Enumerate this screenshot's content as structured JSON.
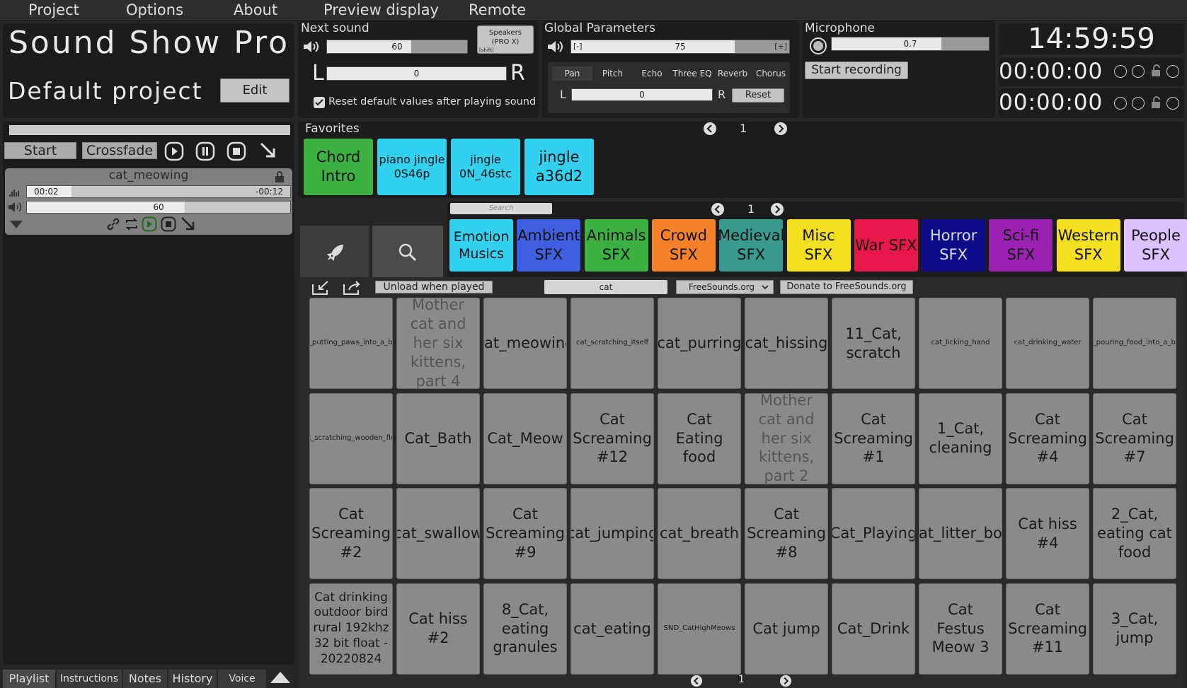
{
  "menu": [
    "Project",
    "Options",
    "About",
    "Preview display",
    "Remote"
  ],
  "app": {
    "title": "Sound Show Pro",
    "project_name": "Default project",
    "edit_label": "Edit"
  },
  "next_sound": {
    "title": "Next sound",
    "volume": "60",
    "volume_level": 0.6,
    "pan": "0",
    "left": "L",
    "right": "R",
    "output_line1": "Speakers",
    "output_line2": "(PRO X)",
    "output_hint": "[shift]",
    "reset_checkbox": "Reset default values after playing sound",
    "reset_checked": true
  },
  "global": {
    "title": "Global Parameters",
    "minus": "[-]",
    "plus": "[+]",
    "volume": "75",
    "volume_level": 0.75,
    "tabs": [
      "Pan",
      "Pitch",
      "Echo",
      "Three EQ",
      "Reverb",
      "Chorus"
    ],
    "pan_value": "0",
    "left": "L",
    "right": "R",
    "reset_label": "Reset"
  },
  "microphone": {
    "title": "Microphone",
    "value": "0.7",
    "level": 0.7,
    "record_label": "Start recording"
  },
  "clock": {
    "time": "14:59:59",
    "timer1": "00:00:00",
    "timer2": "00:00:00"
  },
  "playlist": {
    "start_label": "Start",
    "crossfade_label": "Crossfade",
    "track": {
      "name": "cat_meowing",
      "elapsed": "00:02",
      "remaining": "-00:12",
      "progress": 0.17,
      "volume": "60",
      "volume_level": 0.6
    }
  },
  "favorites": {
    "title": "Favorites",
    "page": "1",
    "items": [
      {
        "label": "Chord Intro",
        "color": "#3cb043"
      },
      {
        "label": "piano jingle 0S46p",
        "color": "#33d1f0"
      },
      {
        "label": "jingle 0N_46stc",
        "color": "#33d1f0"
      },
      {
        "label": "jingle a36d2",
        "color": "#33d1f0"
      }
    ]
  },
  "categories_bar": {
    "search_placeholder": "Search",
    "page": "1",
    "items": [
      {
        "label": "Emotion Musics",
        "color": "#33d1f0",
        "text": "#111"
      },
      {
        "label": "Ambient SFX",
        "color": "#3f5fe0",
        "text": "#111"
      },
      {
        "label": "Animals SFX",
        "color": "#3cb043",
        "text": "#111"
      },
      {
        "label": "Crowd SFX",
        "color": "#f5822a",
        "text": "#111"
      },
      {
        "label": "Medieval SFX",
        "color": "#3a9a90",
        "text": "#111"
      },
      {
        "label": "Misc SFX",
        "color": "#f4e021",
        "text": "#111"
      },
      {
        "label": "War SFX",
        "color": "#e8174a",
        "text": "#111"
      },
      {
        "label": "Horror SFX",
        "color": "#0d0d8a",
        "text": "#ddd"
      },
      {
        "label": "Sci-fi SFX",
        "color": "#9b22b0",
        "text": "#111"
      },
      {
        "label": "Western SFX",
        "color": "#f4e021",
        "text": "#111"
      },
      {
        "label": "People SFX",
        "color": "#dcc2ff",
        "text": "#111"
      }
    ]
  },
  "browser": {
    "unload_label": "Unload when played",
    "search_value": "cat",
    "source_option": "FreeSounds.org",
    "donate_label": "Donate to FreeSounds.org",
    "page": "1",
    "sounds": [
      {
        "label": "cat_putting_paws_into_a_bowl",
        "size": "small"
      },
      {
        "label": "Mother cat and her six kittens, part 4",
        "size": "big",
        "dim": true
      },
      {
        "label": "cat_meowing",
        "size": "big"
      },
      {
        "label": "cat_scratching_itself",
        "size": "small"
      },
      {
        "label": "cat_purring",
        "size": "big"
      },
      {
        "label": "cat_hissing",
        "size": "big"
      },
      {
        "label": "11_Cat, scratch",
        "size": "big"
      },
      {
        "label": "cat_licking_hand",
        "size": "small"
      },
      {
        "label": "cat_drinking_water",
        "size": "small"
      },
      {
        "label": "cat_pouring_food_into_a_bowl",
        "size": "small"
      },
      {
        "label": "cat_scratching_wooden_floor",
        "size": "small"
      },
      {
        "label": "Cat_Bath",
        "size": "big"
      },
      {
        "label": "Cat_Meow",
        "size": "big"
      },
      {
        "label": "Cat Screaming #12",
        "size": "big"
      },
      {
        "label": "Cat Eating food",
        "size": "big"
      },
      {
        "label": "Mother cat and her six kittens, part 2",
        "size": "big",
        "dim": true
      },
      {
        "label": "Cat Screaming #1",
        "size": "big"
      },
      {
        "label": "1_Cat, cleaning",
        "size": "big"
      },
      {
        "label": "Cat Screaming #4",
        "size": "big"
      },
      {
        "label": "Cat Screaming #7",
        "size": "big"
      },
      {
        "label": "Cat Screaming #2",
        "size": "big"
      },
      {
        "label": "cat_swallow",
        "size": "big"
      },
      {
        "label": "Cat Screaming #9",
        "size": "big"
      },
      {
        "label": "cat_jumping",
        "size": "big"
      },
      {
        "label": "cat_breath",
        "size": "big"
      },
      {
        "label": "Cat Screaming #8",
        "size": "big"
      },
      {
        "label": "Cat_Playing",
        "size": "big"
      },
      {
        "label": "cat_litter_box",
        "size": "big"
      },
      {
        "label": "Cat hiss #4",
        "size": "big"
      },
      {
        "label": "2_Cat, eating cat food",
        "size": "big"
      },
      {
        "label": "Cat drinking outdoor bird rural 192khz 32 bit float - 20220824",
        "size": "medium"
      },
      {
        "label": "Cat hiss #2",
        "size": "big"
      },
      {
        "label": "8_Cat, eating granules",
        "size": "big"
      },
      {
        "label": "cat_eating",
        "size": "big"
      },
      {
        "label": "SND_CatHighMeows",
        "size": "small"
      },
      {
        "label": "Cat jump",
        "size": "big"
      },
      {
        "label": "Cat_Drink",
        "size": "big"
      },
      {
        "label": "Cat Festus Meow 3",
        "size": "big"
      },
      {
        "label": "Cat Screaming #11",
        "size": "big"
      },
      {
        "label": "3_Cat, jump",
        "size": "big"
      }
    ]
  },
  "bottom_tabs": [
    "Playlist",
    "Instructions",
    "Notes",
    "History",
    "Voice"
  ]
}
